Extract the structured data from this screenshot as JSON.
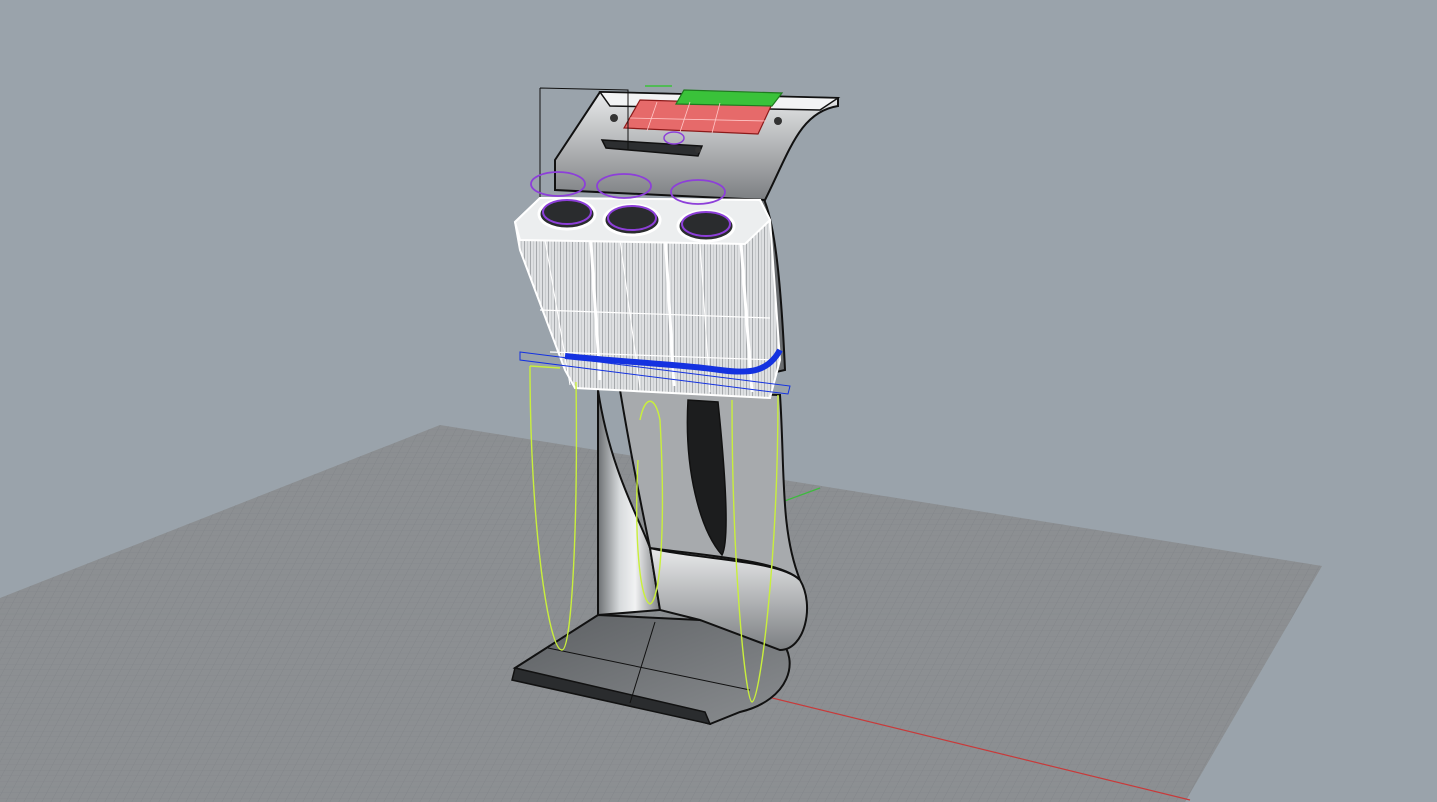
{
  "viewport": {
    "background_color": "#9aa3ab",
    "grid_color": "#8a8d90",
    "grid_line_color": "#7d8185",
    "x_axis_color": "#c83a3a",
    "y_axis_color": "#3dbb3d"
  },
  "model": {
    "body_color": "#d9dcde",
    "body_dark_color": "#5c5f62",
    "outline_color": "#111111",
    "wire_color": "#ffffff",
    "selection_blue": "#1432e0",
    "curve_yellow": "#c9ef3c",
    "circle_purple": "#8d3fd9",
    "panel_red": "#e66a6a",
    "panel_green": "#3ac23a"
  }
}
